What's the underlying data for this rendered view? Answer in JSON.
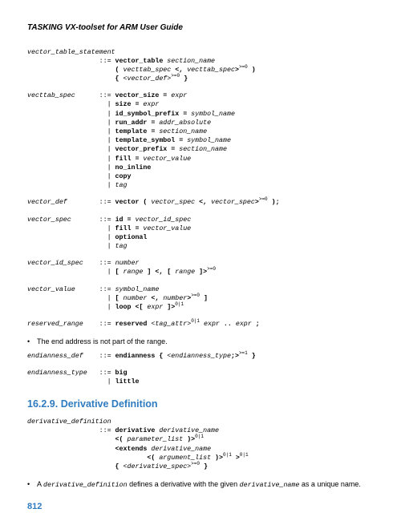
{
  "header": {
    "title": "TASKING VX-toolset for ARM User Guide"
  },
  "grammar": {
    "vector_table_statement": "<span class=\"nt\">vector_table_statement</span>\n                  ::= <span class=\"k\">vector_table</span> <span class=\"nt\">section_name</span>\n                      <span class=\"k\">(</span> <span class=\"nt\">vecttab_spec</span> <span class=\"k\">&lt;,</span> <span class=\"nt\">vecttab_spec</span><span class=\"k\">&gt;</span><sup>&gt;=0</sup> <span class=\"k\">)</span>\n                      <span class=\"k\">{</span> <span class=\"nt\">&lt;vector_def&gt;</span><sup>&gt;=0</sup> <span class=\"k\">}</span>",
    "vecttab_spec": "<span class=\"nt\">vecttab_spec</span>      ::= <span class=\"k\">vector_size =</span> <span class=\"nt\">expr</span>\n                    | <span class=\"k\">size =</span> <span class=\"nt\">expr</span>\n                    | <span class=\"k\">id_symbol_prefix =</span> <span class=\"nt\">symbol_name</span>\n                    | <span class=\"k\">run_addr =</span> <span class=\"nt\">addr_absolute</span>\n                    | <span class=\"k\">template =</span> <span class=\"nt\">section_name</span>\n                    | <span class=\"k\">template_symbol =</span> <span class=\"nt\">symbol_name</span>\n                    | <span class=\"k\">vector_prefix =</span> <span class=\"nt\">section_name</span>\n                    | <span class=\"k\">fill =</span> <span class=\"nt\">vector_value</span>\n                    | <span class=\"k\">no_inline</span>\n                    | <span class=\"k\">copy</span>\n                    | <span class=\"nt\">tag</span>",
    "vector_def": "<span class=\"nt\">vector_def</span>        ::= <span class=\"k\">vector (</span> <span class=\"nt\">vector_spec</span> <span class=\"k\">&lt;,</span> <span class=\"nt\">vector_spec</span><span class=\"k\">&gt;</span><sup>&gt;=0</sup> <span class=\"k\">);</span>",
    "vector_spec": "<span class=\"nt\">vector_spec</span>       ::= <span class=\"k\">id =</span> <span class=\"nt\">vector_id_spec</span>\n                    | <span class=\"k\">fill =</span> <span class=\"nt\">vector_value</span>\n                    | <span class=\"k\">optional</span>\n                    | <span class=\"nt\">tag</span>",
    "vector_id_spec": "<span class=\"nt\">vector_id_spec</span>    ::= <span class=\"nt\">number</span>\n                    | <span class=\"k\">[</span> <span class=\"nt\">range</span> <span class=\"k\">] &lt;, [</span> <span class=\"nt\">range</span> <span class=\"k\">]&gt;</span><sup>&gt;=0</sup>",
    "vector_value": "<span class=\"nt\">vector_value</span>      ::= <span class=\"nt\">symbol_name</span>\n                    | <span class=\"k\">[</span> <span class=\"nt\">number</span> <span class=\"k\">&lt;,</span> <span class=\"nt\">number</span><span class=\"k\">&gt;</span><sup>&gt;=0</sup> <span class=\"k\">]</span>\n                    | <span class=\"k\">loop &lt;[</span> <span class=\"nt\">expr</span> <span class=\"k\">]&gt;</span><sup>0|1</sup>",
    "reserved_range": "<span class=\"nt\">reserved_range</span>    ::= <span class=\"k\">reserved</span> <span class=\"nt\">&lt;tag_attr&gt;</span><sup>0|1</sup> <span class=\"nt\">expr</span> <span class=\"k\">..</span> <span class=\"nt\">expr</span> <span class=\"k\">;</span>",
    "endianness_def": "<span class=\"nt\">endianness_def</span>    ::= <span class=\"k\">endianness {</span> <span class=\"nt\">&lt;endianness_type</span><span class=\"k\">;&gt;</span><sup>&gt;=1</sup> <span class=\"k\">}</span>",
    "endianness_type": "<span class=\"nt\">endianness_type</span>   ::= <span class=\"k\">big</span>\n                    | <span class=\"k\">little</span>",
    "derivative_definition": "<span class=\"nt\">derivative_definition</span>\n                  ::= <span class=\"k\">derivative</span> <span class=\"nt\">derivative_name</span>\n                      <span class=\"k\">&lt;(</span> <span class=\"nt\">parameter_list</span> <span class=\"k\">)&gt;</span><sup>0|1</sup>\n                      <span class=\"k\">&lt;extends</span> <span class=\"nt\">derivative_name</span>\n                              <span class=\"k\">&lt;(</span> <span class=\"nt\">argument_list</span> <span class=\"k\">)&gt;</span><sup>0|1</sup> <span class=\"k\">&gt;</span><sup>0|1</sup>\n                      <span class=\"k\">{</span> <span class=\"nt\">&lt;derivative_spec&gt;</span><sup>&gt;=0</sup> <span class=\"k\">}</span>"
  },
  "notes": {
    "end_address": "The end address is not part of the range.",
    "derivative_bullet_prefix": "A ",
    "derivative_code": "derivative_definition",
    "derivative_text_mid": " defines a derivative with the given ",
    "derivative_code2": "derivative_name",
    "derivative_text_end": " as a unique name."
  },
  "section": {
    "heading": "16.2.9. Derivative Definition"
  },
  "page": {
    "number": "812"
  }
}
